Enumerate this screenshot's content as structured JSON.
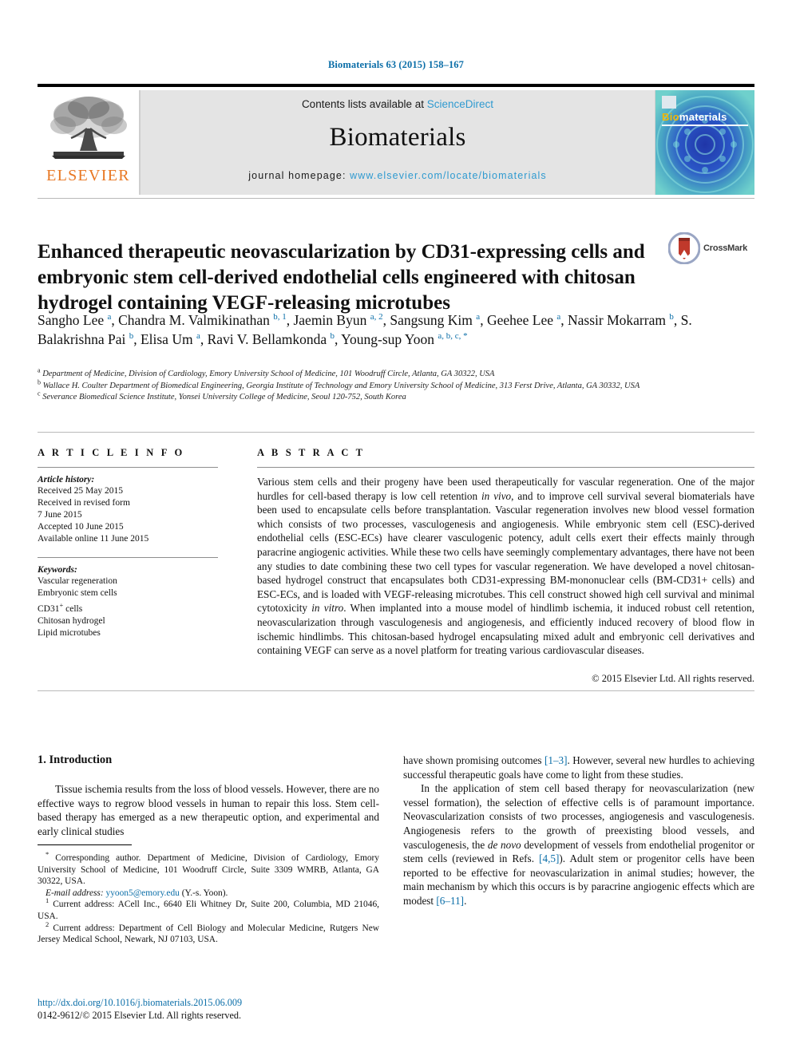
{
  "running_head": "Biomaterials 63 (2015) 158–167",
  "masthead": {
    "publisher_logo_text": "ELSEVIER",
    "contents_prefix": "Contents lists available at ",
    "contents_link": "ScienceDirect",
    "journal_name": "Biomaterials",
    "homepage_label": "journal homepage: ",
    "homepage_url": "www.elsevier.com/locate/biomaterials",
    "cover_title_bio": "Bio",
    "cover_title_materials": "materials"
  },
  "article": {
    "title": "Enhanced therapeutic neovascularization by CD31-expressing cells and embryonic stem cell-derived endothelial cells engineered with chitosan hydrogel containing VEGF-releasing microtubes",
    "crossmark_label": "CrossMark",
    "authors": [
      {
        "name": "Sangho Lee",
        "marks": "a",
        "sep": ", "
      },
      {
        "name": "Chandra M. Valmikinathan",
        "marks": "b, 1",
        "sep": ", "
      },
      {
        "name": "Jaemin Byun",
        "marks": "a, 2",
        "sep": ", "
      },
      {
        "name": "Sangsung Kim",
        "marks": "a",
        "sep": ", "
      },
      {
        "name": "Geehee Lee",
        "marks": "a",
        "sep": ", "
      },
      {
        "name": "Nassir Mokarram",
        "marks": "b",
        "sep": ", "
      },
      {
        "name": "S. Balakrishna Pai",
        "marks": "b",
        "sep": ", "
      },
      {
        "name": "Elisa Um",
        "marks": "a",
        "sep": ", "
      },
      {
        "name": "Ravi V. Bellamkonda",
        "marks": "b",
        "sep": ", "
      },
      {
        "name": "Young-sup Yoon",
        "marks": "a, b, c, *",
        "sep": ""
      }
    ],
    "affiliations": [
      {
        "mark": "a",
        "text": "Department of Medicine, Division of Cardiology, Emory University School of Medicine, 101 Woodruff Circle, Atlanta, GA 30322, USA"
      },
      {
        "mark": "b",
        "text": "Wallace H. Coulter Department of Biomedical Engineering, Georgia Institute of Technology and Emory University School of Medicine, 313 Ferst Drive, Atlanta, GA 30332, USA"
      },
      {
        "mark": "c",
        "text": "Severance Biomedical Science Institute, Yonsei University College of Medicine, Seoul 120-752, South Korea"
      }
    ]
  },
  "article_info": {
    "heading": "A R T I C L E  I N F O",
    "history_title": "Article history:",
    "history": [
      "Received 25 May 2015",
      "Received in revised form",
      "7 June 2015",
      "Accepted 10 June 2015",
      "Available online 11 June 2015"
    ],
    "keywords_title": "Keywords:",
    "keywords": [
      "Vascular regeneration",
      "Embryonic stem cells",
      "CD31+ cells",
      "Chitosan hydrogel",
      "Lipid microtubes"
    ]
  },
  "abstract": {
    "heading": "A B S T R A C T",
    "paragraph_1": "Various stem cells and their progeny have been used therapeutically for vascular regeneration. One of the major hurdles for cell-based therapy is low cell retention ",
    "italic_1": "in vivo",
    "paragraph_2": ", and to improve cell survival several biomaterials have been used to encapsulate cells before transplantation. Vascular regeneration involves new blood vessel formation which consists of two processes, vasculogenesis and angiogenesis. While embryonic stem cell (ESC)-derived endothelial cells (ESC-ECs) have clearer vasculogenic potency, adult cells exert their effects mainly through paracrine angiogenic activities. While these two cells have seemingly complementary advantages, there have not been any studies to date combining these two cell types for vascular regeneration. We have developed a novel chitosan-based hydrogel construct that encapsulates both CD31-expressing BM-mononuclear cells (BM-CD31+ cells) and ESC-ECs, and is loaded with VEGF-releasing microtubes. This cell construct showed high cell survival and minimal cytotoxicity ",
    "italic_2": "in vitro",
    "paragraph_3": ". When implanted into a mouse model of hindlimb ischemia, it induced robust cell retention, neovascularization through vasculogenesis and angiogenesis, and efficiently induced recovery of blood flow in ischemic hindlimbs. This chitosan-based hydrogel encapsulating mixed adult and embryonic cell derivatives and containing VEGF can serve as a novel platform for treating various cardiovascular diseases.",
    "copyright": "© 2015 Elsevier Ltd. All rights reserved."
  },
  "body": {
    "intro_heading": "1. Introduction",
    "left_para_1": "Tissue ischemia results from the loss of blood vessels. However, there are no effective ways to regrow blood vessels in human to repair this loss. Stem cell-based therapy has emerged as a new therapeutic option, and experimental and early clinical studies",
    "right_para_1a": "have shown promising outcomes ",
    "right_ref_1": "[1–3]",
    "right_para_1b": ". However, several new hurdles to achieving successful therapeutic goals have come to light from these studies.",
    "right_para_2a": "In the application of stem cell based therapy for neovascularization (new vessel formation), the selection of effective cells is of paramount importance. Neovascularization consists of two processes, angiogenesis and vasculogenesis. Angiogenesis refers to the growth of preexisting blood vessels, and vasculogenesis, the ",
    "right_italic_1": "de novo",
    "right_para_2b": " development of vessels from endothelial progenitor or stem cells (reviewed in Refs. ",
    "right_ref_2": "[4,5]",
    "right_para_2c": "). Adult stem or progenitor cells have been reported to be effective for neovascularization in animal studies; however, the main mechanism by which this occurs is by paracrine angiogenic effects which are modest ",
    "right_ref_3": "[6–11]",
    "right_para_2d": "."
  },
  "footnotes": {
    "corresponding_mark": "*",
    "corresponding": " Corresponding author. Department of Medicine, Division of Cardiology, Emory University School of Medicine, 101 Woodruff Circle, Suite 3309 WMRB, Atlanta, GA 30322, USA.",
    "email_label": "E-mail address:",
    "email": "yyoon5@emory.edu",
    "email_owner": "(Y.-s. Yoon).",
    "note_1_mark": "1",
    "note_1": " Current address: ACell Inc., 6640 Eli Whitney Dr, Suite 200, Columbia, MD 21046, USA.",
    "note_2_mark": "2",
    "note_2": " Current address: Department of Cell Biology and Molecular Medicine, Rutgers New Jersey Medical School, Newark, NJ 07103, USA.",
    "doi": "http://dx.doi.org/10.1016/j.biomaterials.2015.06.009",
    "issn_line": "0142-9612/© 2015 Elsevier Ltd. All rights reserved."
  },
  "colors": {
    "link": "#0b6ea8",
    "sciencedirect": "#2f9ad0",
    "elsevier_orange": "#E87722",
    "banner_bg": "#e4e4e4"
  }
}
